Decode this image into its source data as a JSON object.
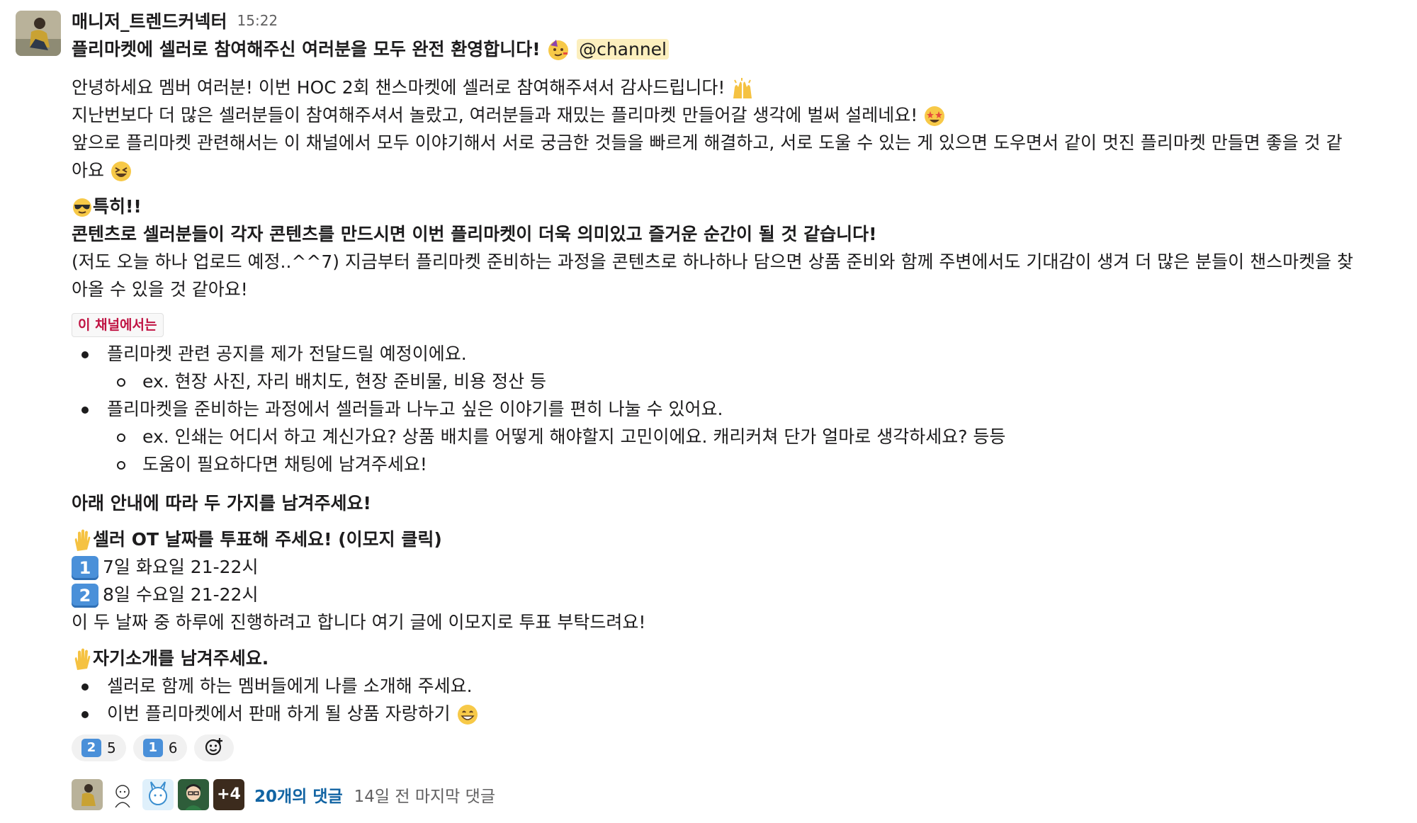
{
  "message": {
    "sender": "매니저_트렌드커넥터",
    "time": "15:22",
    "title": "플리마켓에 셀러로 참여해주신 여러분을 모두 완전 환영합니다!",
    "mention": "@channel",
    "intro": [
      "안녕하세요 멤버 여러분! 이번 HOC 2회 챈스마켓에 셀러로 참여해주셔서 감사드립니다!",
      "지난번보다 더 많은 셀러분들이 참여해주셔서 놀랐고, 여러분들과 재밌는 플리마켓 만들어갈 생각에 벌써 설레네요!",
      "앞으로 플리마켓 관련해서는 이 채널에서 모두 이야기해서 서로 궁금한 것들을 빠르게 해결하고, 서로 도울 수 있는 게 있으면 도우면서 같이 멋진 플리마켓 만들면 좋을 것 같",
      "아요"
    ],
    "special_heading": "특히!!",
    "special_bold": "콘텐츠로 셀러분들이 각자 콘텐츠를 만드시면 이번 플리마켓이 더욱 의미있고 즐거운 순간이 될 것 같습니다!",
    "special_text": [
      "(저도 오늘 하나 업로드 예정..^^7) 지금부터 플리마켓 준비하는 과정을 콘텐츠로 하나하나 담으면 상품 준비와 함께 주변에서도 기대감이 생겨 더 많은 분들이 챈스마켓을 찾",
      "아올 수 있을 것 같아요!"
    ],
    "channel_tag": "이 채널에서는",
    "channel_list": [
      {
        "text": "플리마켓 관련 공지를 제가 전달드릴 예정이에요.",
        "sub": [
          "ex. 현장 사진, 자리 배치도, 현장 준비물, 비용 정산 등"
        ]
      },
      {
        "text": "플리마켓을 준비하는 과정에서 셀러들과 나누고 싶은 이야기를 편히 나눌 수 있어요.",
        "sub": [
          "ex. 인쇄는 어디서 하고 계신가요? 상품 배치를 어떻게 해야할지 고민이에요. 캐리커쳐 단가 얼마로 생각하세요? 등등",
          "도움이 필요하다면 채팅에 남겨주세요!"
        ]
      }
    ],
    "guide": "아래 안내에 따라 두 가지를 남겨주세요!",
    "ot_heading": "셀러 OT 날짜를 투표해 주세요! (이모지 클릭)",
    "ot_options": [
      {
        "key": "1",
        "text": "7일 화요일 21-22시"
      },
      {
        "key": "2",
        "text": "8일 수요일 21-22시"
      }
    ],
    "ot_note": "이 두 날짜 중 하루에 진행하려고 합니다 여기 글에 이모지로 투표 부탁드려요!",
    "intro_heading": "자기소개를 남겨주세요.",
    "intro_list": [
      "셀러로 함께 하는 멤버들에게 나를 소개해 주세요.",
      "이번 플리마켓에서 판매 하게 될 상품 자랑하기"
    ]
  },
  "reactions": [
    {
      "emoji": "keycap-2",
      "key": "2",
      "count": "5"
    },
    {
      "emoji": "keycap-1",
      "key": "1",
      "count": "6"
    }
  ],
  "add_reaction_icon": "add-reaction-icon",
  "thread": {
    "more_count": "+4",
    "replies": "20개의 댓글",
    "last_reply": "14일 전 마지막 댓글"
  },
  "colors": {
    "link": "#1264a3",
    "mention_bg": "#fcefbe",
    "tag_text": "#c01343",
    "keycap": "#4a90d9"
  }
}
